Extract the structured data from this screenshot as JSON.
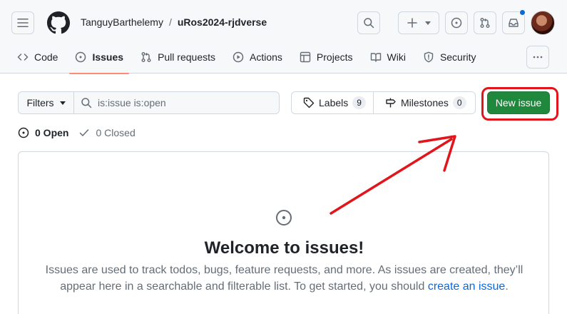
{
  "header": {
    "owner": "TanguyBarthelemy",
    "separator": "/",
    "repo": "uRos2024-rjdverse",
    "icons": [
      "menu-icon",
      "github-logo",
      "search-icon",
      "plus-icon",
      "issue-opened-icon",
      "pull-request-icon",
      "inbox-icon"
    ],
    "notification_color": "#0969da"
  },
  "tabs": [
    {
      "label": "Code",
      "icon": "code-icon"
    },
    {
      "label": "Issues",
      "icon": "issue-opened-icon",
      "active": true
    },
    {
      "label": "Pull requests",
      "icon": "pull-request-icon"
    },
    {
      "label": "Actions",
      "icon": "play-icon"
    },
    {
      "label": "Projects",
      "icon": "table-icon"
    },
    {
      "label": "Wiki",
      "icon": "book-icon"
    },
    {
      "label": "Security",
      "icon": "shield-icon"
    }
  ],
  "toolbar": {
    "filters_label": "Filters",
    "search_value": "is:issue is:open",
    "labels_label": "Labels",
    "labels_count": "9",
    "milestones_label": "Milestones",
    "milestones_count": "0",
    "new_issue_label": "New issue",
    "accent": "#1f883d",
    "annotation_color": "#e0161c"
  },
  "states": {
    "open_label": "0 Open",
    "closed_label": "0 Closed"
  },
  "blankslate": {
    "title": "Welcome to issues!",
    "description_1": "Issues are used to track todos, bugs, feature requests, and more. As issues are created, they’ll appear here in a searchable and filterable list. To get started, you should ",
    "link": "create an issue",
    "description_2": "."
  }
}
